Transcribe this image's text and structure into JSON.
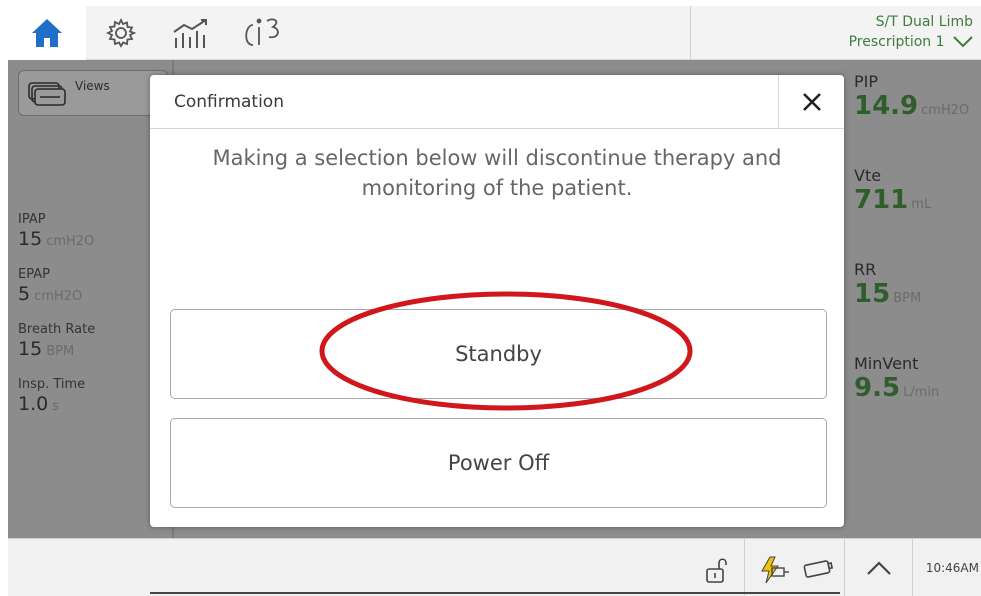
{
  "topbar": {
    "tabs": [
      "home-icon",
      "settings-icon",
      "trends-icon",
      "info-icon"
    ],
    "mode_line1": "S/T  Dual Limb",
    "mode_line2": "Prescription 1"
  },
  "views": {
    "label": "Views"
  },
  "settings": [
    {
      "label": "IPAP",
      "value": "15",
      "unit": "cmH2O"
    },
    {
      "label": "EPAP",
      "value": "5",
      "unit": "cmH2O"
    },
    {
      "label": "Breath Rate",
      "value": "15",
      "unit": "BPM"
    },
    {
      "label": "Insp. Time",
      "value": "1.0",
      "unit": "s"
    }
  ],
  "measurements": [
    {
      "label": "PIP",
      "value": "14.9",
      "unit": "cmH2O"
    },
    {
      "label": "Vte",
      "value": "711",
      "unit": "mL"
    },
    {
      "label": "RR",
      "value": "15",
      "unit": "BPM"
    },
    {
      "label": "MinVent",
      "value": "9.5",
      "unit": "L/min"
    }
  ],
  "dialog": {
    "title": "Confirmation",
    "message": "Making a selection below will discontinue therapy and monitoring of the patient.",
    "standby_label": "Standby",
    "poweroff_label": "Power Off"
  },
  "bottombar": {
    "time": "10:46AM"
  },
  "colors": {
    "accent_blue": "#1f6fc9",
    "mode_green": "#3e7d3b",
    "value_green": "#2f5e2c",
    "annotation_red": "#d0171b"
  }
}
